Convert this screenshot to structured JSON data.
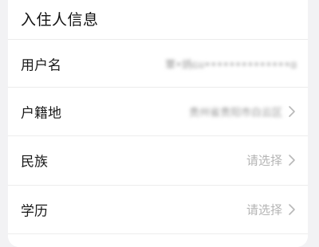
{
  "section": {
    "title": "入住人信息"
  },
  "rows": [
    {
      "label": "用户名",
      "value": "覃•炳ɢᴜ••••••••••••••ɑ",
      "blurred": true,
      "has_chevron": false
    },
    {
      "label": "户籍地",
      "value": "贵州省贵阳市白云区",
      "blurred": true,
      "has_chevron": true
    },
    {
      "label": "民族",
      "value": "请选择",
      "blurred": false,
      "has_chevron": true
    },
    {
      "label": "学历",
      "value": "请选择",
      "blurred": false,
      "has_chevron": true
    }
  ],
  "colors": {
    "background": "#f2f2f4",
    "card": "#ffffff",
    "label": "#1a1a1a",
    "placeholder": "#b5b5b5",
    "chevron": "#b8b8b8"
  },
  "icons": {
    "chevron": "chevron-right-icon"
  }
}
